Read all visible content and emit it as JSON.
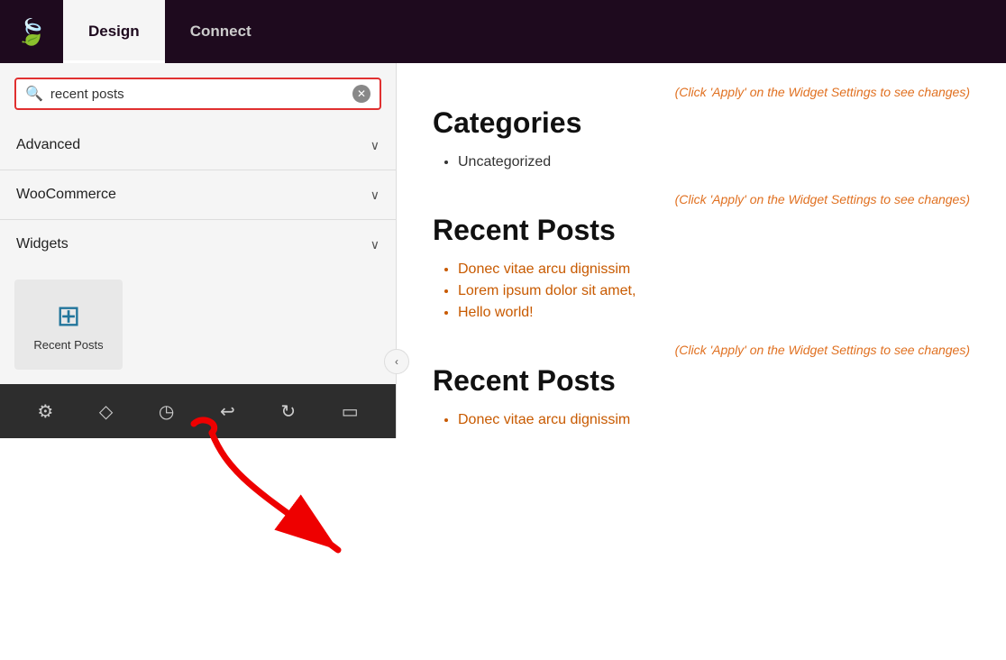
{
  "header": {
    "logo_symbol": "🍃",
    "tabs": [
      {
        "label": "Design",
        "active": true
      },
      {
        "label": "Connect",
        "active": false
      }
    ]
  },
  "sidebar": {
    "search": {
      "value": "recent posts",
      "placeholder": "recent posts"
    },
    "sections": [
      {
        "id": "advanced",
        "label": "Advanced",
        "expanded": false
      },
      {
        "id": "woocommerce",
        "label": "WooCommerce",
        "expanded": false
      },
      {
        "id": "widgets",
        "label": "Widgets",
        "expanded": true
      }
    ],
    "widgets": [
      {
        "id": "recent-posts",
        "label": "Recent Posts",
        "icon": "wp"
      }
    ]
  },
  "bottom_toolbar": {
    "icons": [
      "⚙",
      "◇",
      "🕐",
      "↩",
      "↻",
      "📱"
    ]
  },
  "content": {
    "sections": [
      {
        "hint": "(Click 'Apply' on the Widget Settings to see changes)",
        "title": "Categories",
        "list": [
          {
            "text": "Uncategorized",
            "orange": false
          }
        ]
      },
      {
        "hint": "(Click 'Apply' on the Widget Settings to see changes)",
        "title": "Recent Posts",
        "list": [
          {
            "text": "Donec vitae arcu dignissim",
            "orange": true
          },
          {
            "text": "Lorem ipsum dolor sit amet,",
            "orange": true
          },
          {
            "text": "Hello world!",
            "orange": true
          }
        ]
      },
      {
        "hint": "(Click 'Apply' on the Widget Settings to see changes)",
        "title": "Recent Posts",
        "list": [
          {
            "text": "Donec vitae arcu dignissim",
            "orange": true
          }
        ]
      }
    ]
  }
}
